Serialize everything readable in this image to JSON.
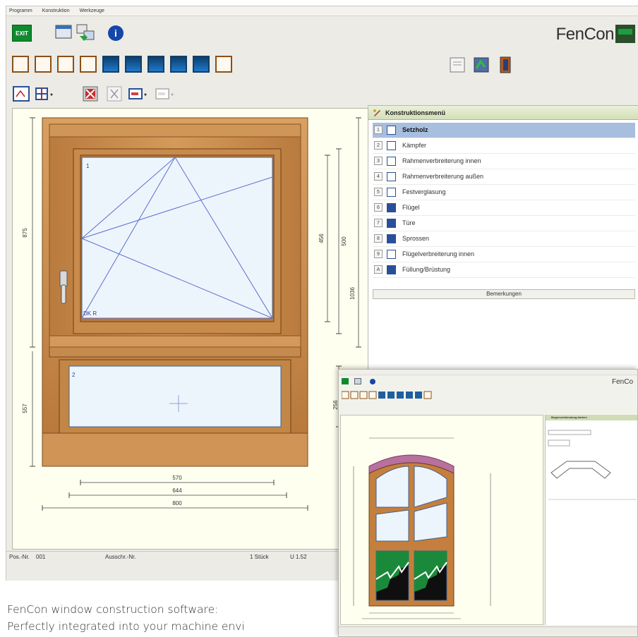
{
  "menubar": {
    "items": [
      "Programm",
      "Konstruktion",
      "Werkzeuge"
    ]
  },
  "toolbar": {
    "exit_label": "EXIT"
  },
  "brand": {
    "name": "FenCon"
  },
  "drawing": {
    "sash1_number": "1",
    "sash1_opening": "DK R",
    "sash2_number": "2",
    "dim_left_top": "875",
    "dim_left_bottom": "557",
    "dim_right_inner": "456",
    "dim_right_mid": "500",
    "dim_right_total": "1036",
    "dim_right_low": "256",
    "dim_bottom_1": "570",
    "dim_bottom_2": "644",
    "dim_bottom_3": "800"
  },
  "status": {
    "pos": "Pos.-Nr.",
    "pos_value": "001",
    "aussch": "Ausschr.-Nr.",
    "pieces": "1 Stück",
    "uvalue": "U 1.52"
  },
  "panel": {
    "title": "Konstruktionsmenü",
    "items": [
      {
        "num": "1",
        "label": "Setzholz"
      },
      {
        "num": "2",
        "label": "Kämpfer"
      },
      {
        "num": "3",
        "label": "Rahmenverbreiterung innen"
      },
      {
        "num": "4",
        "label": "Rahmenverbreiterung außen"
      },
      {
        "num": "5",
        "label": "Festverglasung"
      },
      {
        "num": "6",
        "label": "Flügel"
      },
      {
        "num": "7",
        "label": "Türe"
      },
      {
        "num": "8",
        "label": "Sprossen"
      },
      {
        "num": "9",
        "label": "Flügelverbreiterung innen"
      },
      {
        "num": "A",
        "label": "Füllung/Brüstung"
      }
    ],
    "remarks": "Bemerkungen"
  },
  "shot2": {
    "brand": "FenCo",
    "panel_title": "Bogenverblendung ändern"
  },
  "caption": {
    "line1": "FenCon window construction software:",
    "line2": "Perfectly integrated into your machine envi"
  },
  "colors": {
    "wood": "#c68a4a",
    "glass": "#e9f3fb",
    "accent": "#1a7a2e",
    "selection": "#a8bedf"
  }
}
